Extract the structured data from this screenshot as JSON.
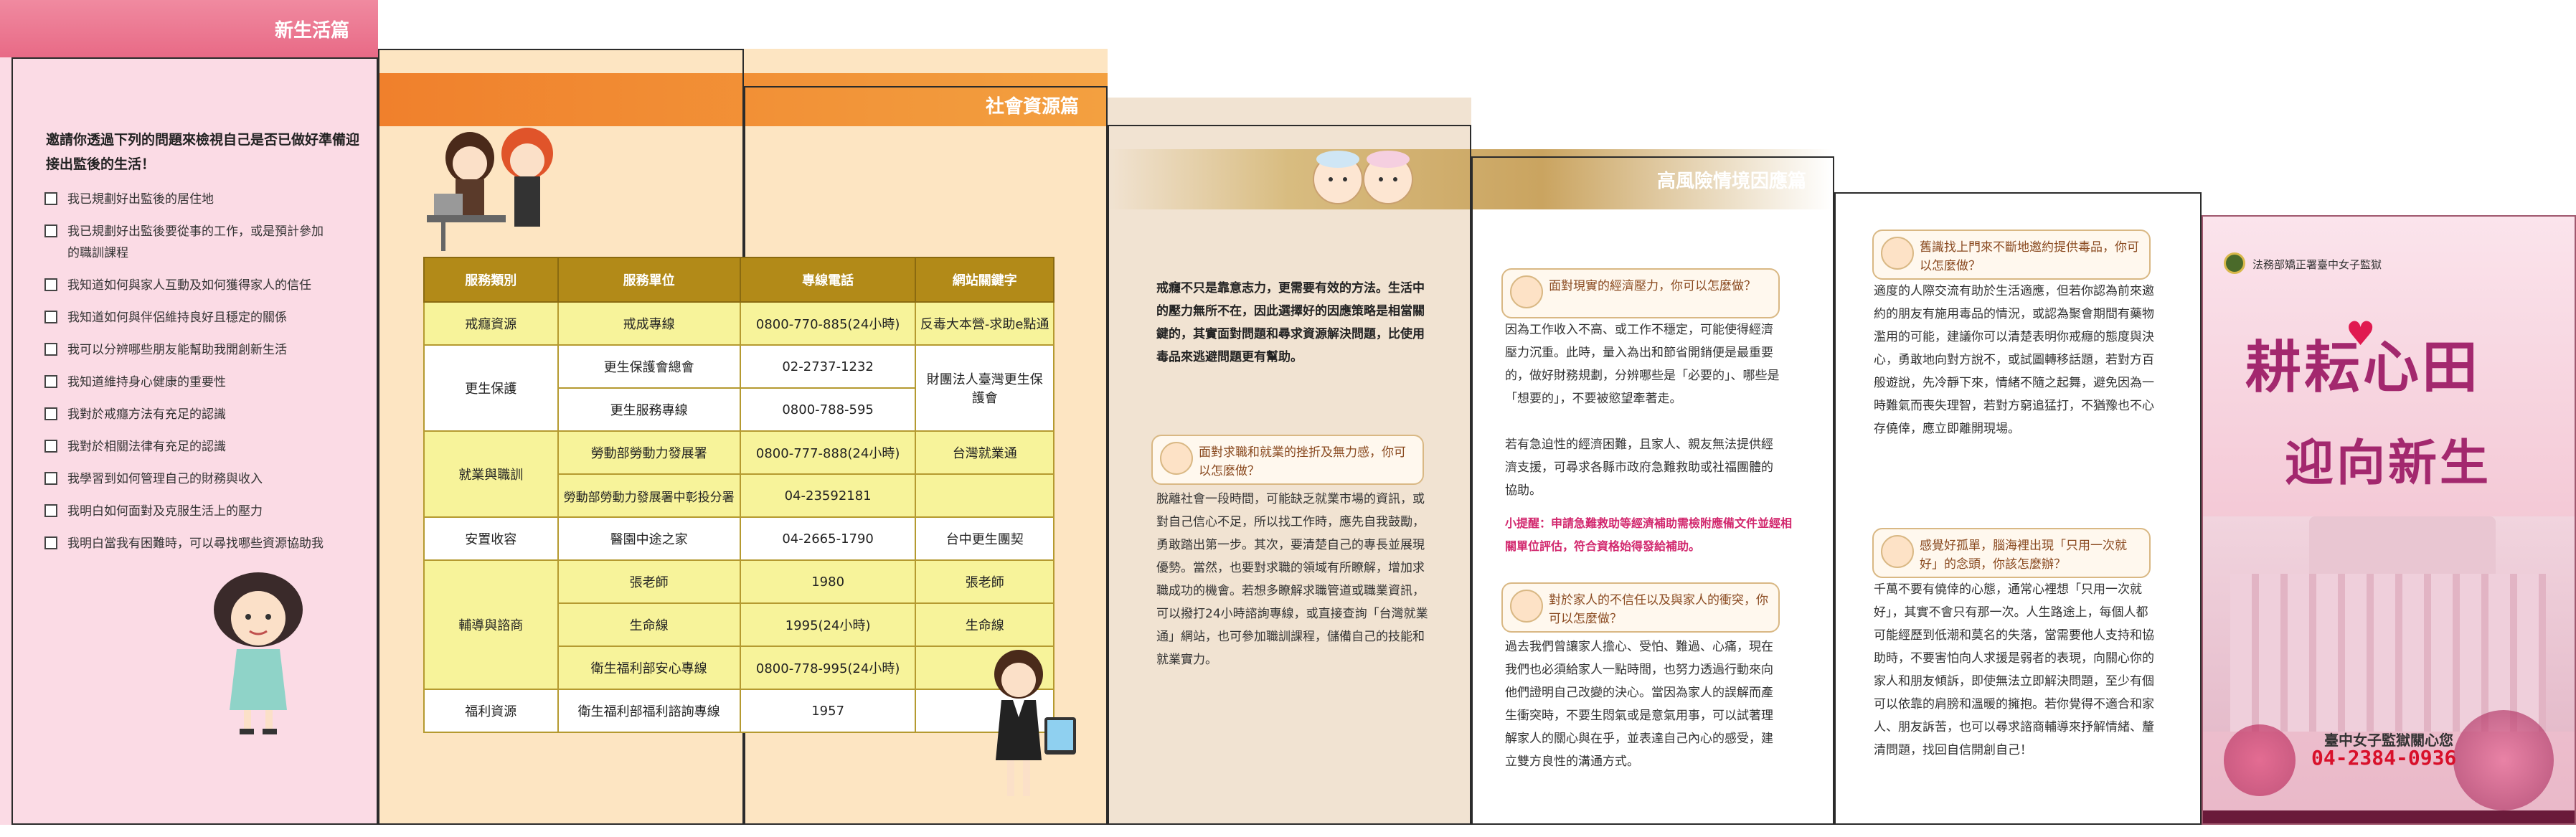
{
  "panel1": {
    "header": "新生活篇",
    "intro": "邀請你透過下列的問題來檢視自己是否已做好準備迎接出監後的生活！",
    "checklist": [
      "我已規劃好出監後的居住地",
      "我已規劃好出監後要從事的工作，或是預計參加",
      "的職訓課程",
      "我知道如何與家人互動及如何獲得家人的信任",
      "我知道如何與伴侶維持良好且穩定的關係",
      "我可以分辨哪些朋友能幫助我開創新生活",
      "我知道維持身心健康的重要性",
      "我對於戒癮方法有充足的認識",
      "我對於相關法律有充足的認識",
      "我學習到如何管理自己的財務與收入",
      "我明白如何面對及克服生活上的壓力",
      "我明白當我有困難時，可以尋找哪些資源協助我"
    ]
  },
  "panel3": {
    "header": "社會資源篇"
  },
  "table": {
    "headers": [
      "服務類別",
      "服務單位",
      "專線電話",
      "網站關鍵字"
    ],
    "rows": {
      "r1": {
        "cat": "戒癮資源",
        "unit": "戒成專線",
        "phone": "0800-770-885(24小時)",
        "web": "反毒大本營-求助e點通"
      },
      "r2": {
        "cat": "更生保護",
        "unit": "更生保護會總會",
        "phone": "02-2737-1232",
        "web": "財團法人臺灣更生保護會"
      },
      "r3": {
        "unit": "更生服務專線",
        "phone": "0800-788-595"
      },
      "r4": {
        "cat": "就業與職訓",
        "unit": "勞動部勞動力發展署",
        "phone": "0800-777-888(24小時)",
        "web": "台灣就業通"
      },
      "r5": {
        "unit": "勞動部勞動力發展署中彰投分署",
        "phone": "04-23592181"
      },
      "r6": {
        "cat": "安置收容",
        "unit": "醫園中途之家",
        "phone": "04-2665-1790",
        "web": "台中更生團契"
      },
      "r7": {
        "cat": "輔導與諮商",
        "unit": "張老師",
        "phone": "1980",
        "web": "張老師"
      },
      "r8": {
        "unit": "生命線",
        "phone": "1995(24小時)",
        "web": "生命線"
      },
      "r9": {
        "unit": "衛生福利部安心專線",
        "phone": "0800-778-995(24小時)"
      },
      "r10": {
        "cat": "福利資源",
        "unit": "衛生福利部福利諮詢專線",
        "phone": "1957"
      }
    }
  },
  "panel4": {
    "intro": "戒癮不只是靠意志力，更需要有效的方法。生活中的壓力無所不在，因此選擇好的因應策略是相當關鍵的，其實面對問題和尋求資源解決問題，比使用毒品來逃避問題更有幫助。",
    "q1": "面對求職和就業的挫折及無力感，你可以怎麼做？",
    "a1": "脫離社會一段時間，可能缺乏就業市場的資訊，或對自己信心不足，所以找工作時，應先自我鼓勵，勇敢踏出第一步。其次，要清楚自己的專長並展現優勢。當然，也要對求職的領域有所瞭解，增加求職成功的機會。若想多瞭解求職管道或職業資訊，可以撥打24小時諮詢專線，或直接查詢「台灣就業通」網站，也可參加職訓課程，儲備自己的技能和就業實力。"
  },
  "panel5": {
    "header": "高風險情境因應篇",
    "q1": "面對現實的經濟壓力，你可以怎麼做？",
    "a1": "因為工作收入不高、或工作不穩定，可能使得經濟壓力沉重。此時，量入為出和節省開銷便是最重要的，做好財務規劃，分辨哪些是「必要的」、哪些是「想要的」，不要被慾望牽著走。",
    "a1b": "若有急迫性的經濟困難，且家人、親友無法提供經濟支援，可尋求各縣市政府急難救助或社福團體的協助。",
    "tip": "小提醒：申請急難救助等經濟補助需檢附應備文件並經相關單位評估，符合資格始得發給補助。",
    "q2": "對於家人的不信任以及與家人的衝突，你可以怎麼做？",
    "a2": "過去我們曾讓家人擔心、受怕、難過、心痛，現在我們也必須給家人一點時間，也努力透過行動來向他們證明自己改變的決心。當因為家人的誤解而產生衝突時，不要生悶氣或是意氣用事，可以試著理解家人的關心與在乎，並表達自己內心的感受，建立雙方良性的溝通方式。"
  },
  "panel6": {
    "q1": "舊識找上門來不斷地邀約提供毒品，你可以怎麼做？",
    "a1": "適度的人際交流有助於生活適應，但若你認為前來邀約的朋友有施用毒品的情況，或認為聚會期間有藥物濫用的可能，建議你可以清楚表明你戒癮的態度與決心，勇敢地向對方說不，或試圖轉移話題，若對方百般遊說，先冷靜下來，情緒不隨之起舞，避免因為一時難氣而喪失理智，若對方窮追猛打，不猶豫也不心存僥倖，應立即離開現場。",
    "q2": "感覺好孤單，腦海裡出現「只用一次就好」的念頭，你該怎麼辦？",
    "a2": "千萬不要有僥倖的心態，通常心裡想「只用一次就好」，其實不會只有那一次。人生路途上，每個人都可能經歷到低潮和莫名的失落，當需要他人支持和協助時，不要害怕向人求援是弱者的表現，向關心你的家人和朋友傾訴，即使無法立即解決問題，至少有個可以依靠的肩膀和溫暖的擁抱。若你覺得不適合和家人、朋友訴苦，也可以尋求諮商輔導來抒解情緒、釐清問題，找回自信開創自己！"
  },
  "cover": {
    "org": "法務部矯正署臺中女子監獄",
    "title1": "耕耘心田",
    "title2": "迎向新生",
    "contact_label": "臺中女子監獄關心您",
    "phone": "04-2384-0936"
  },
  "colors": {
    "pink_band": "#e86a86",
    "orange_bar": "#f0802c",
    "table_header": "#b28a18",
    "cover_title": "#a3286e",
    "phone_red": "#d8102a"
  }
}
